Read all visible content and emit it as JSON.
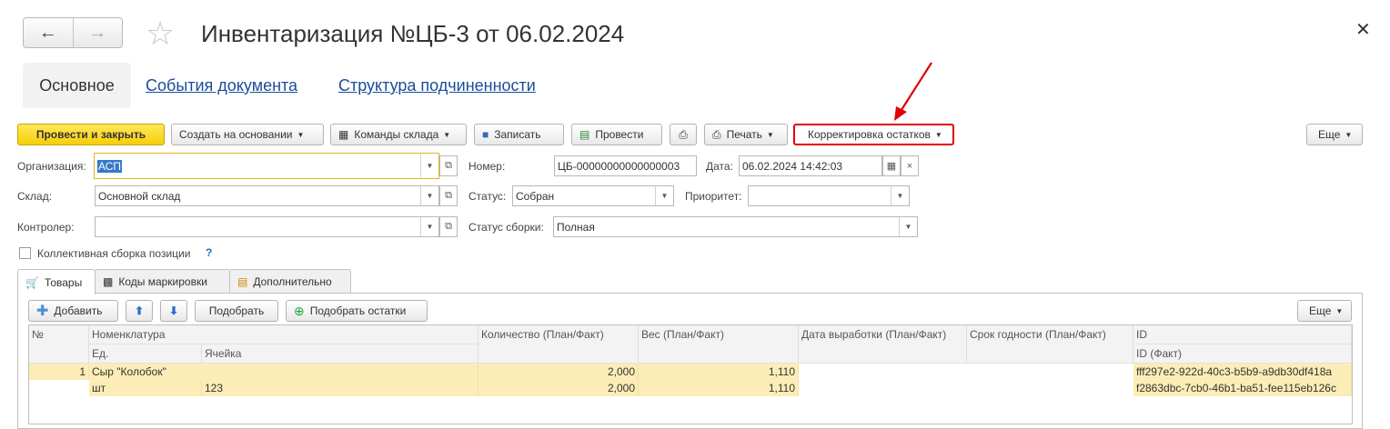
{
  "header": {
    "back_icon": "←",
    "forward_icon": "→",
    "star_icon": "☆",
    "title": "Инвентаризация №ЦБ-3 от 06.02.2024",
    "close_icon": "✕"
  },
  "section_tabs": [
    "Основное",
    "События документа",
    "Структура подчиненности"
  ],
  "toolbar": {
    "post_close": "Провести и закрыть",
    "create_based": "Создать на основании",
    "warehouse_cmds": "Команды склада",
    "save": "Записать",
    "post": "Провести",
    "print": "Печать",
    "adjust": "Корректировка остатков",
    "more": "Еще"
  },
  "form": {
    "org_label": "Организация:",
    "org_value": "АСП",
    "number_label": "Номер:",
    "number_value": "ЦБ-00000000000000003",
    "date_label": "Дата:",
    "date_value": "06.02.2024 14:42:03",
    "warehouse_label": "Склад:",
    "warehouse_value": "Основной склад",
    "status_label": "Статус:",
    "status_value": "Собран",
    "priority_label": "Приоритет:",
    "priority_value": "",
    "controller_label": "Контролер:",
    "controller_value": "",
    "assembly_status_label": "Статус сборки:",
    "assembly_status_value": "Полная",
    "collective_label": "Коллективная сборка позиции",
    "help_mark": "?"
  },
  "inner_tabs": [
    "Товары",
    "Коды маркировки",
    "Дополнительно"
  ],
  "table_toolbar": {
    "add": "Добавить",
    "pick": "Подобрать",
    "pick_remains": "Подобрать остатки",
    "more": "Еще"
  },
  "table": {
    "headers": {
      "no": "№",
      "nomenclature": "Номенклатура",
      "unit": "Ед.",
      "cell": "Ячейка",
      "quantity": "Количество (План/Факт)",
      "weight": "Вес (План/Факт)",
      "production_date": "Дата выработки (План/Факт)",
      "expiry": "Срок годности (План/Факт)",
      "id": "ID",
      "id_fact": "ID (Факт)"
    },
    "rows": [
      {
        "no": "1",
        "nomenclature": "Сыр \"Колобок\"",
        "unit": "шт",
        "cell": "123",
        "qty_plan": "2,000",
        "qty_fact": "2,000",
        "weight_plan": "1,110",
        "weight_fact": "1,110",
        "id": "fff297e2-922d-40c3-b5b9-a9db30df418a",
        "id_fact": "f2863dbc-7cb0-46b1-ba51-fee115eb126c"
      }
    ]
  },
  "colors": {
    "primary_button": "#f7cd08",
    "highlight_border": "#e00000",
    "link": "#1a4d99",
    "row_highlight": "#fbedb5"
  }
}
